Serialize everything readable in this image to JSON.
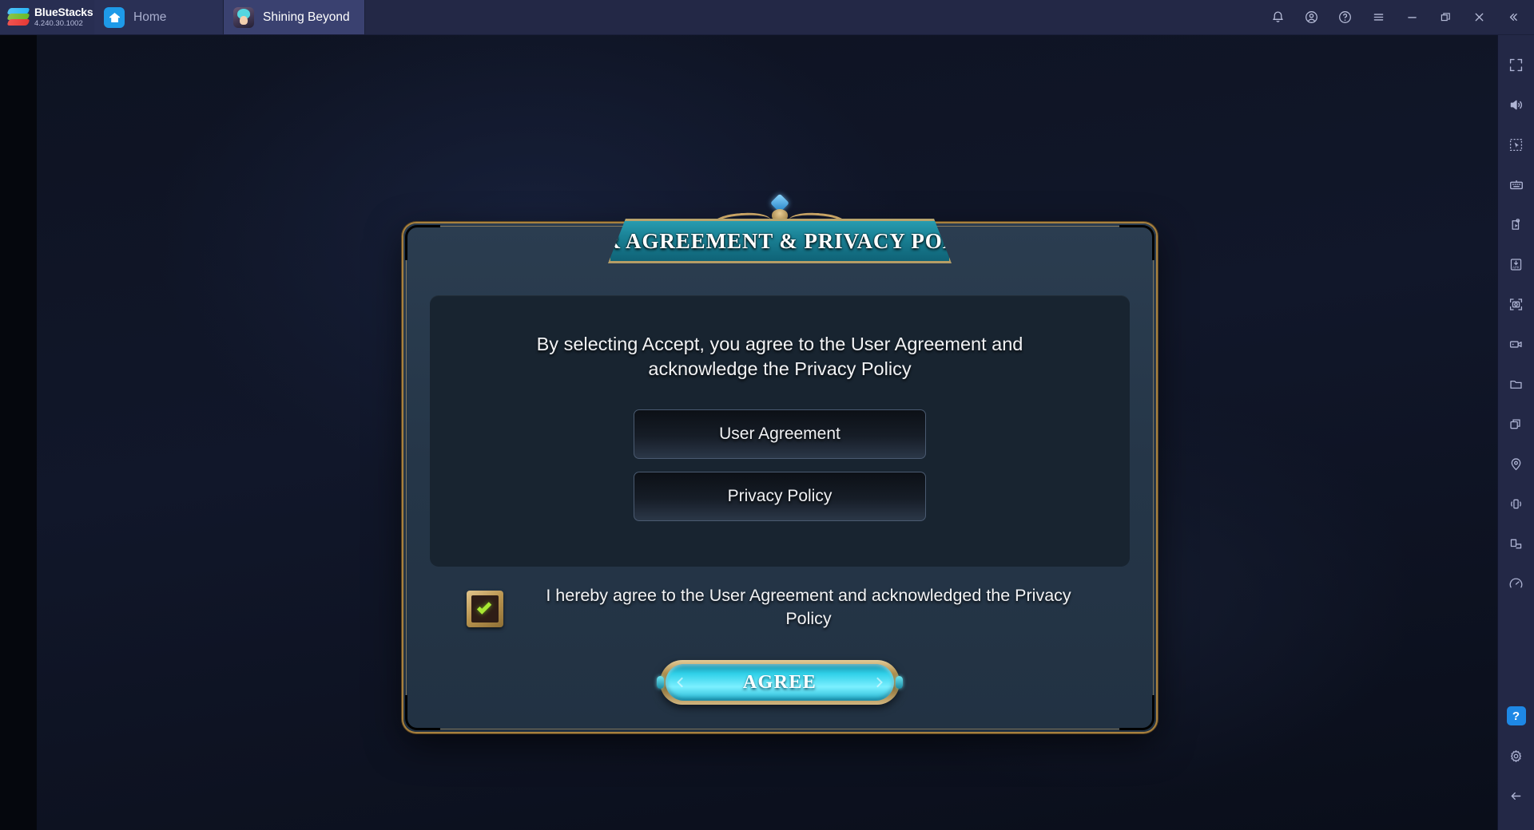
{
  "titlebar": {
    "brand_name": "BlueStacks",
    "version": "4.240.30.1002",
    "tabs": [
      {
        "label": "Home",
        "icon": "home-icon",
        "active": false
      },
      {
        "label": "Shining Beyond",
        "icon": "game-icon",
        "active": true
      }
    ],
    "controls": [
      {
        "name": "notifications-icon"
      },
      {
        "name": "account-icon"
      },
      {
        "name": "help-icon"
      },
      {
        "name": "menu-icon"
      },
      {
        "name": "minimize-icon"
      },
      {
        "name": "maximize-icon"
      },
      {
        "name": "close-icon"
      },
      {
        "name": "collapse-icon"
      }
    ]
  },
  "sidebar": {
    "top_items": [
      {
        "name": "fullscreen-icon"
      },
      {
        "name": "volume-icon"
      },
      {
        "name": "cursor-select-icon"
      },
      {
        "name": "keyboard-controls-icon"
      },
      {
        "name": "macro-script-icon"
      },
      {
        "name": "install-apk-icon"
      },
      {
        "name": "screenshot-icon"
      },
      {
        "name": "record-video-icon"
      },
      {
        "name": "media-folder-icon"
      },
      {
        "name": "multi-instance-icon"
      },
      {
        "name": "location-icon"
      },
      {
        "name": "shake-icon"
      },
      {
        "name": "rotate-icon"
      },
      {
        "name": "performance-icon"
      }
    ],
    "bottom_items": [
      {
        "name": "help-badge-icon",
        "label": "?"
      },
      {
        "name": "settings-gear-icon"
      },
      {
        "name": "back-arrow-icon"
      }
    ]
  },
  "dialog": {
    "title": "USER AGREEMENT & PRIVACY POLICY",
    "intro": "By selecting Accept, you agree to the User Agreement and acknowledge the Privacy Policy",
    "documents": [
      {
        "label": "User Agreement"
      },
      {
        "label": "Privacy Policy"
      }
    ],
    "consent": {
      "checked": true,
      "text": "I hereby agree to the User Agreement and acknowledged the Privacy Policy"
    },
    "primary_action": "AGREE"
  },
  "colors": {
    "titlebar_bg": "#232846",
    "tab_active_bg": "#3a4170",
    "dialog_bg": "#253648",
    "panel_bg": "#182430",
    "gold": "#c8a465",
    "banner_teal": "#1a8296",
    "agree_cyan": "#2fd0e8",
    "check_green": "#a8e832",
    "accent_blue": "#1e88e5"
  }
}
